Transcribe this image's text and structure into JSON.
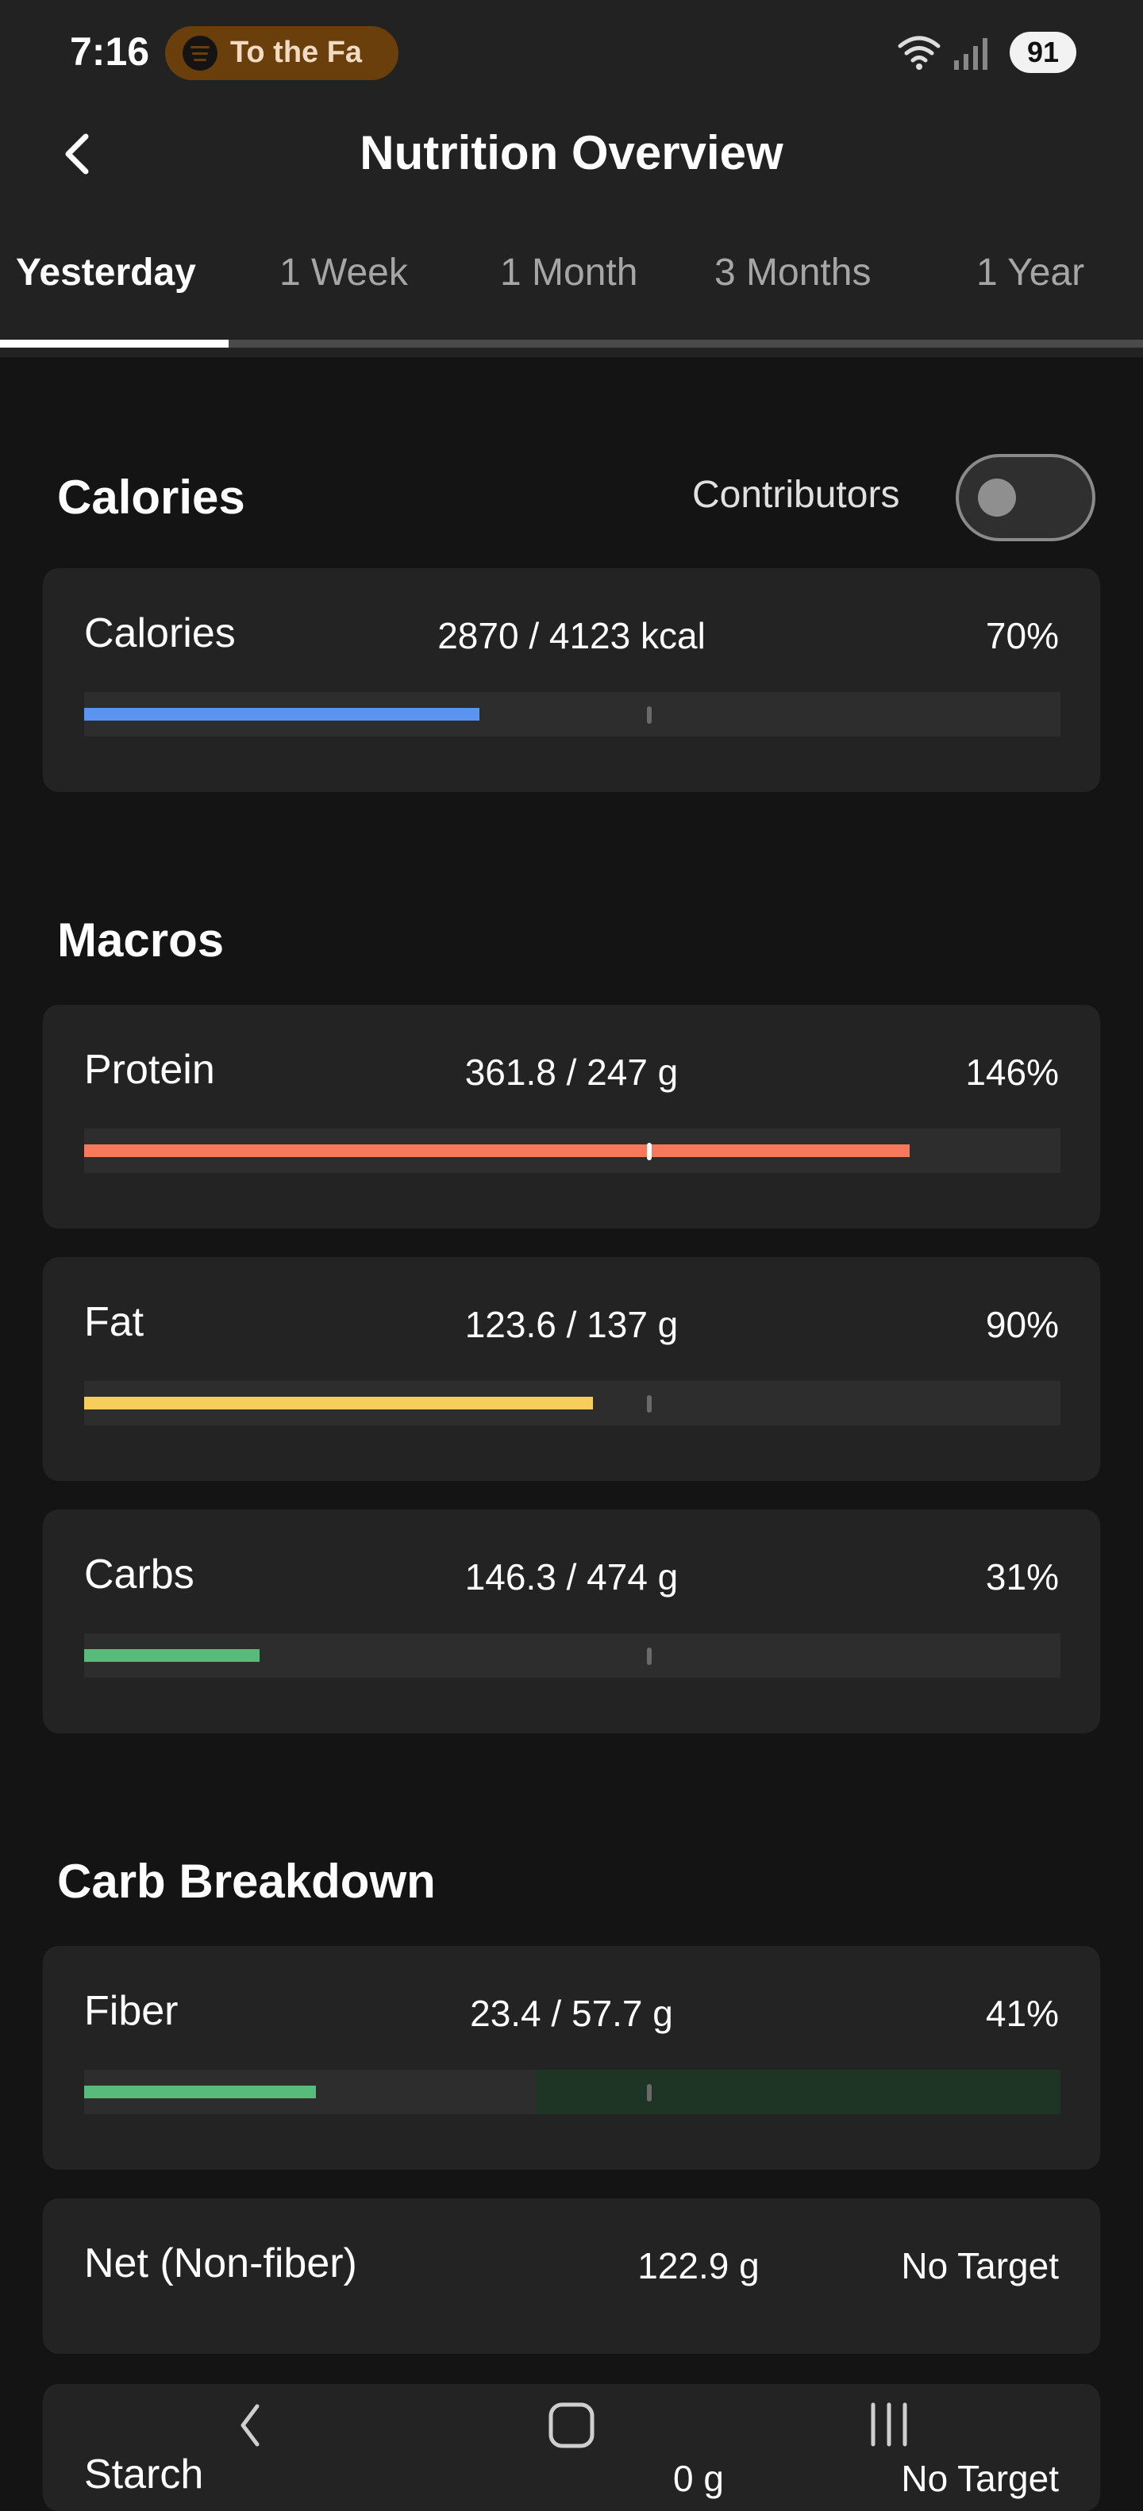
{
  "status_bar": {
    "time": "7:16",
    "media": "To the Fa",
    "battery": "91"
  },
  "header": {
    "title": "Nutrition Overview",
    "tabs": [
      "Yesterday",
      "1 Week",
      "1 Month",
      "3 Months",
      "1 Year"
    ],
    "active_tab": "Yesterday"
  },
  "calories_section": {
    "title": "Calories",
    "contributors_label": "Contributors",
    "contributors_on": false,
    "card": {
      "label": "Calories",
      "value": "2870 / 4123 kcal",
      "percent": "70%",
      "progress": 0.7,
      "color": "#5b93f0"
    }
  },
  "macros": {
    "title": "Macros",
    "items": [
      {
        "label": "Protein",
        "value": "361.8 / 247 g",
        "percent": "146%",
        "progress": 1.46,
        "color": "#f5795a"
      },
      {
        "label": "Fat",
        "value": "123.6 / 137 g",
        "percent": "90%",
        "progress": 0.9,
        "color": "#f7cd5b"
      },
      {
        "label": "Carbs",
        "value": "146.3 / 474 g",
        "percent": "31%",
        "progress": 0.31,
        "color": "#58bb7b"
      }
    ]
  },
  "carb_breakdown": {
    "title": "Carb Breakdown",
    "items": [
      {
        "label": "Fiber",
        "value": "23.4 / 57.7 g",
        "percent": "41%",
        "progress": 0.41,
        "color": "#58bb7b",
        "target_zone_start": 0.8
      },
      {
        "label": "Net (Non-fiber)",
        "value": "122.9 g",
        "percent": "No Target"
      },
      {
        "label": "Starch",
        "value": "0 g",
        "percent": "No Target"
      }
    ]
  },
  "colors": {
    "background": "#141414",
    "card": "#232323",
    "header": "#222222",
    "target_zone": "#1e3526"
  },
  "icons": {
    "back": "chevron-left-icon",
    "wifi": "wifi-icon",
    "signal": "signal-icon",
    "spotify": "spotify-icon"
  },
  "nav": [
    "back-nav-icon",
    "home-nav-icon",
    "recents-nav-icon"
  ]
}
